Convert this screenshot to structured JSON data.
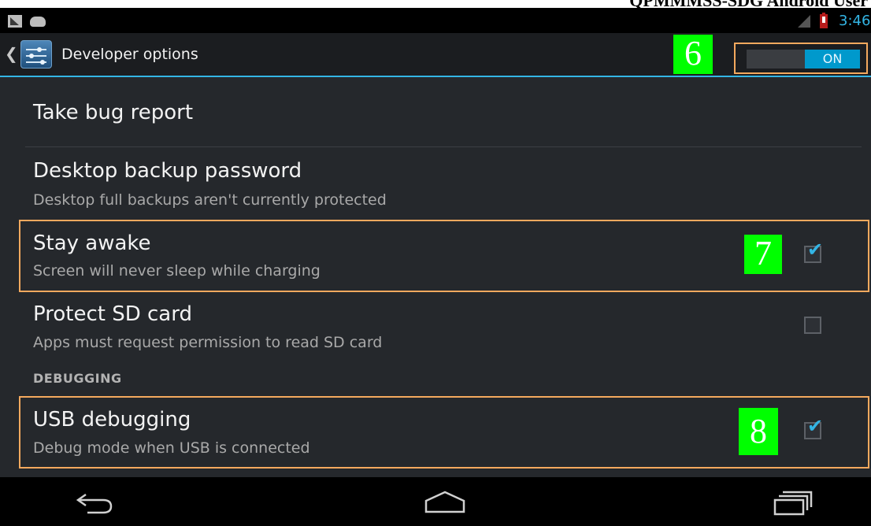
{
  "document": {
    "header_fragment": "QPMMMSS-SDG Android User"
  },
  "status_bar": {
    "time": "3:46",
    "left_icons": [
      "gallery-notification-icon",
      "android-notification-icon"
    ],
    "right_icons": [
      "signal-icon",
      "battery-low-icon"
    ]
  },
  "action_bar": {
    "title": "Developer options",
    "toggle_state": "ON",
    "icon": "developer-settings-icon"
  },
  "annotations": {
    "toggle_badge": "6",
    "stay_awake_badge": "7",
    "usb_debugging_badge": "8",
    "badge_color": "#00ff00",
    "highlight_color": "#f4a95e"
  },
  "settings": {
    "take_bug_report": {
      "title": "Take bug report"
    },
    "desktop_backup": {
      "title": "Desktop backup password",
      "summary": "Desktop full backups aren't currently protected"
    },
    "stay_awake": {
      "title": "Stay awake",
      "summary": "Screen will never sleep while charging",
      "checked": true
    },
    "protect_sd": {
      "title": "Protect SD card",
      "summary": "Apps must request permission to read SD card",
      "checked": false
    },
    "debugging_header": "DEBUGGING",
    "usb_debugging": {
      "title": "USB debugging",
      "summary": "Debug mode when USB is connected",
      "checked": true
    }
  },
  "nav_bar": {
    "buttons": [
      "back-icon",
      "home-icon",
      "recent-apps-icon"
    ]
  },
  "colors": {
    "accent": "#33b5e5",
    "background": "#25282c",
    "toggle_on": "#0099cc"
  }
}
